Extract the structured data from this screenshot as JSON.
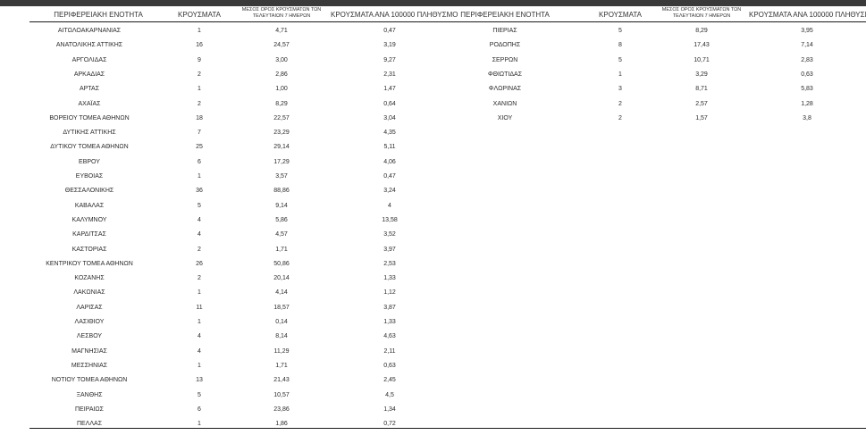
{
  "headers": {
    "region": "ΠΕΡΙΦΕΡΕΙΑΚΗ ΕΝΟΤΗΤΑ",
    "cases": "ΚΡΟΥΣΜΑΤΑ",
    "avg": "ΜΕΣΟΣ ΟΡΟΣ ΚΡΟΥΣΜΑΤΩΝ ΤΩΝ ΤΕΛΕΥΤΑΙΩΝ 7 ΗΜΕΡΩΝ",
    "rate": "ΚΡΟΥΣΜΑΤΑ ΑΝΑ 100000 ΠΛΗΘΥΣΜΟ"
  },
  "left_rows": [
    {
      "name": "ΑΙΤΩΛΟΑΚΑΡΝΑΝΙΑΣ",
      "cases": "1",
      "avg": "4,71",
      "rate": "0,47"
    },
    {
      "name": "ΑΝΑΤΟΛΙΚΗΣ ΑΤΤΙΚΗΣ",
      "cases": "16",
      "avg": "24,57",
      "rate": "3,19"
    },
    {
      "name": "ΑΡΓΟΛΙΔΑΣ",
      "cases": "9",
      "avg": "3,00",
      "rate": "9,27"
    },
    {
      "name": "ΑΡΚΑΔΙΑΣ",
      "cases": "2",
      "avg": "2,86",
      "rate": "2,31"
    },
    {
      "name": "ΑΡΤΑΣ",
      "cases": "1",
      "avg": "1,00",
      "rate": "1,47"
    },
    {
      "name": "ΑΧΑΪΑΣ",
      "cases": "2",
      "avg": "8,29",
      "rate": "0,64"
    },
    {
      "name": "ΒΟΡΕΙΟΥ ΤΟΜΕΑ ΑΘΗΝΩΝ",
      "cases": "18",
      "avg": "22,57",
      "rate": "3,04"
    },
    {
      "name": "ΔΥΤΙΚΗΣ ΑΤΤΙΚΗΣ",
      "cases": "7",
      "avg": "23,29",
      "rate": "4,35"
    },
    {
      "name": "ΔΥΤΙΚΟΥ ΤΟΜΕΑ ΑΘΗΝΩΝ",
      "cases": "25",
      "avg": "29,14",
      "rate": "5,11"
    },
    {
      "name": "ΕΒΡΟΥ",
      "cases": "6",
      "avg": "17,29",
      "rate": "4,06"
    },
    {
      "name": "ΕΥΒΟΙΑΣ",
      "cases": "1",
      "avg": "3,57",
      "rate": "0,47"
    },
    {
      "name": "ΘΕΣΣΑΛΟΝΙΚΗΣ",
      "cases": "36",
      "avg": "88,86",
      "rate": "3,24"
    },
    {
      "name": "ΚΑΒΑΛΑΣ",
      "cases": "5",
      "avg": "9,14",
      "rate": "4"
    },
    {
      "name": "ΚΑΛΥΜΝΟΥ",
      "cases": "4",
      "avg": "5,86",
      "rate": "13,58"
    },
    {
      "name": "ΚΑΡΔΙΤΣΑΣ",
      "cases": "4",
      "avg": "4,57",
      "rate": "3,52"
    },
    {
      "name": "ΚΑΣΤΟΡΙΑΣ",
      "cases": "2",
      "avg": "1,71",
      "rate": "3,97"
    },
    {
      "name": "ΚΕΝΤΡΙΚΟΥ ΤΟΜΕΑ ΑΘΗΝΩΝ",
      "cases": "26",
      "avg": "50,86",
      "rate": "2,53"
    },
    {
      "name": "ΚΟΖΑΝΗΣ",
      "cases": "2",
      "avg": "20,14",
      "rate": "1,33"
    },
    {
      "name": "ΛΑΚΩΝΙΑΣ",
      "cases": "1",
      "avg": "4,14",
      "rate": "1,12"
    },
    {
      "name": "ΛΑΡΙΣΑΣ",
      "cases": "11",
      "avg": "18,57",
      "rate": "3,87"
    },
    {
      "name": "ΛΑΣΙΘΙΟΥ",
      "cases": "1",
      "avg": "0,14",
      "rate": "1,33"
    },
    {
      "name": "ΛΕΣΒΟΥ",
      "cases": "4",
      "avg": "8,14",
      "rate": "4,63"
    },
    {
      "name": "ΜΑΓΝΗΣΙΑΣ",
      "cases": "4",
      "avg": "11,29",
      "rate": "2,11"
    },
    {
      "name": "ΜΕΣΣΗΝΙΑΣ",
      "cases": "1",
      "avg": "1,71",
      "rate": "0,63"
    },
    {
      "name": "ΝΟΤΙΟΥ ΤΟΜΕΑ ΑΘΗΝΩΝ",
      "cases": "13",
      "avg": "21,43",
      "rate": "2,45"
    },
    {
      "name": "ΞΑΝΘΗΣ",
      "cases": "5",
      "avg": "10,57",
      "rate": "4,5"
    },
    {
      "name": "ΠΕΙΡΑΙΩΣ",
      "cases": "6",
      "avg": "23,86",
      "rate": "1,34"
    },
    {
      "name": "ΠΕΛΛΑΣ",
      "cases": "1",
      "avg": "1,86",
      "rate": "0,72"
    }
  ],
  "right_rows": [
    {
      "name": "ΠΙΕΡΙΑΣ",
      "cases": "5",
      "avg": "8,29",
      "rate": "3,95"
    },
    {
      "name": "ΡΟΔΟΠΗΣ",
      "cases": "8",
      "avg": "17,43",
      "rate": "7,14"
    },
    {
      "name": "ΣΕΡΡΩΝ",
      "cases": "5",
      "avg": "10,71",
      "rate": "2,83"
    },
    {
      "name": "ΦΘΙΩΤΙΔΑΣ",
      "cases": "1",
      "avg": "3,29",
      "rate": "0,63"
    },
    {
      "name": "ΦΛΩΡΙΝΑΣ",
      "cases": "3",
      "avg": "8,71",
      "rate": "5,83"
    },
    {
      "name": "ΧΑΝΙΩΝ",
      "cases": "2",
      "avg": "2,57",
      "rate": "1,28"
    },
    {
      "name": "ΧΙΟΥ",
      "cases": "2",
      "avg": "1,57",
      "rate": "3,8"
    }
  ]
}
